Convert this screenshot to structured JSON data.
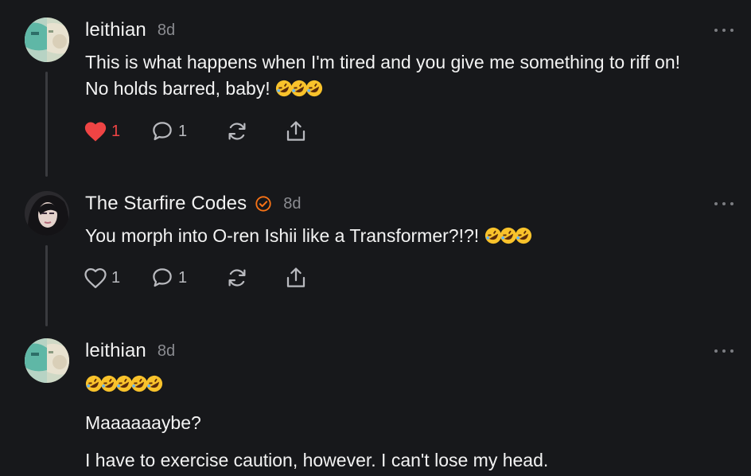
{
  "posts": [
    {
      "username": "leithian",
      "time": "8d",
      "lines": [
        "This is what happens when I'm tired and you give me something to riff on!",
        "No holds barred, baby!"
      ],
      "likes": "1",
      "liked": true,
      "replies": "1"
    },
    {
      "username": "The Starfire Codes",
      "verified": true,
      "time": "8d",
      "lines": [
        "You morph into O-ren Ishii like a Transformer?!?!"
      ],
      "likes": "1",
      "liked": false,
      "replies": "1"
    },
    {
      "username": "leithian",
      "time": "8d",
      "lines": [
        "Maaaaaaybe?",
        "I have to exercise caution, however. I can't lose my head."
      ]
    }
  ],
  "icons": {
    "like": "heart-icon",
    "reply": "speech-bubble-icon",
    "repost": "repost-icon",
    "share": "share-icon",
    "more": "ellipsis-icon",
    "emoji": "rolling-on-floor-laughing-emoji"
  },
  "colors": {
    "background": "#17181b",
    "liked": "#ef4444",
    "verified": "#f97316",
    "muted": "#8b8c91"
  }
}
